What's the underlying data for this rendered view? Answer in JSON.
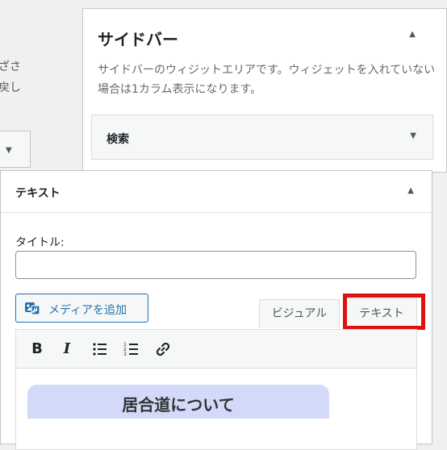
{
  "left_panel": {
    "text_line1": "ざさ",
    "text_line2": "戻し"
  },
  "sidebar": {
    "title": "サイドバー",
    "description": "サイドバーのウィジットエリアです。ウィジェットを入れていない場合は1カラム表示になります。",
    "search_widget": {
      "title": "検索"
    }
  },
  "text_widget": {
    "title": "テキスト",
    "title_label": "タイトル:",
    "title_value": "",
    "add_media_label": "メディアを追加",
    "tabs": {
      "visual": "ビジュアル",
      "text": "テキスト"
    },
    "toolbar": [
      "bold",
      "italic",
      "bulleted-list",
      "numbered-list",
      "link"
    ],
    "content_heading": "居合道について"
  },
  "colors": {
    "highlight": "#e01010",
    "accent": "#2271b1",
    "heading_bg": "#d3daf9"
  }
}
